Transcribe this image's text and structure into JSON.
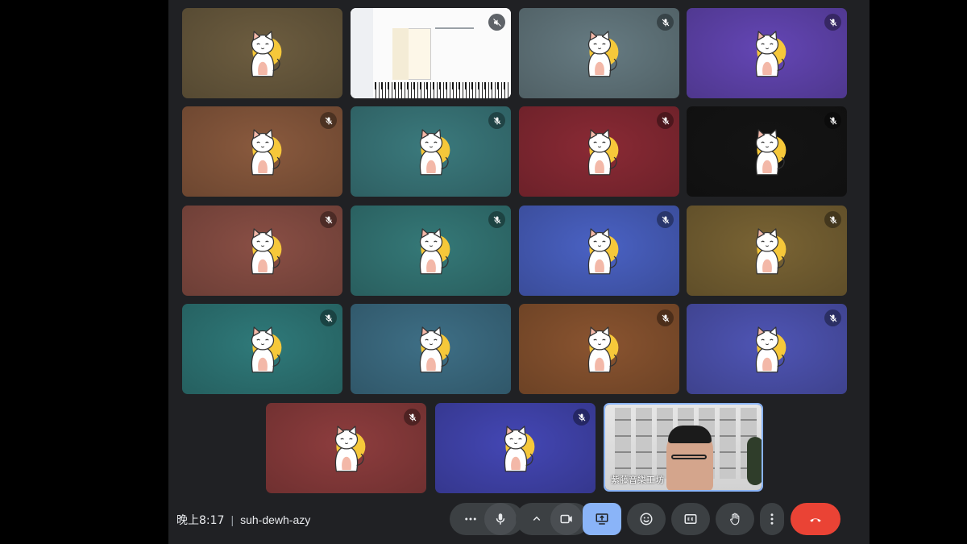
{
  "meeting": {
    "time": "晚上8:17",
    "separator": "|",
    "code": "suh-dewh-azy"
  },
  "self": {
    "name": "紫藤音樂工坊"
  },
  "colors": {
    "stage_bg": "#202124",
    "control_bg": "#3c4043",
    "present_active": "#8ab4f8",
    "end_call": "#ea4335",
    "self_border": "#8ab4f8"
  },
  "tiles": [
    {
      "row": 1,
      "col": 1,
      "kind": "avatar",
      "muted": false,
      "bg": "#6d5d40"
    },
    {
      "row": 1,
      "col": 2,
      "kind": "screen-share",
      "muted": false,
      "audio_off": true
    },
    {
      "row": 1,
      "col": 3,
      "kind": "avatar",
      "muted": true,
      "bg": "#667b82"
    },
    {
      "row": 1,
      "col": 4,
      "kind": "avatar",
      "muted": true,
      "bg": "#6446b5"
    },
    {
      "row": 2,
      "col": 1,
      "kind": "avatar",
      "muted": true,
      "bg": "#8a5a3e"
    },
    {
      "row": 2,
      "col": 2,
      "kind": "avatar",
      "muted": true,
      "bg": "#3b7a7d"
    },
    {
      "row": 2,
      "col": 3,
      "kind": "avatar",
      "muted": true,
      "bg": "#8a2a35"
    },
    {
      "row": 2,
      "col": 4,
      "kind": "avatar",
      "muted": true,
      "bg": "#141414"
    },
    {
      "row": 3,
      "col": 1,
      "kind": "avatar",
      "muted": true,
      "bg": "#8a4f45"
    },
    {
      "row": 3,
      "col": 2,
      "kind": "avatar",
      "muted": true,
      "bg": "#357978"
    },
    {
      "row": 3,
      "col": 3,
      "kind": "avatar",
      "muted": true,
      "bg": "#4a62c4"
    },
    {
      "row": 3,
      "col": 4,
      "kind": "avatar",
      "muted": true,
      "bg": "#7a6434"
    },
    {
      "row": 4,
      "col": 1,
      "kind": "avatar",
      "muted": true,
      "bg": "#2f7a7a"
    },
    {
      "row": 4,
      "col": 2,
      "kind": "avatar",
      "muted": false,
      "bg": "#3e6f86"
    },
    {
      "row": 4,
      "col": 3,
      "kind": "avatar",
      "muted": true,
      "bg": "#8a5430"
    },
    {
      "row": 4,
      "col": 4,
      "kind": "avatar",
      "muted": true,
      "bg": "#4f55b5"
    },
    {
      "row": 5,
      "col": 1,
      "kind": "avatar",
      "muted": true,
      "bg": "#8e3d3e"
    },
    {
      "row": 5,
      "col": 2,
      "kind": "avatar",
      "muted": true,
      "bg": "#4447b5"
    },
    {
      "row": 5,
      "col": 3,
      "kind": "self-video",
      "muted": false
    }
  ],
  "controls": [
    {
      "id": "more-options-left",
      "icon": "more-horiz-icon"
    },
    {
      "id": "microphone",
      "icon": "mic-icon"
    },
    {
      "id": "camera-options",
      "icon": "chevron-up-icon"
    },
    {
      "id": "camera",
      "icon": "videocam-icon"
    },
    {
      "id": "present",
      "icon": "present-screen-icon",
      "active": true
    },
    {
      "id": "reactions",
      "icon": "emoji-icon"
    },
    {
      "id": "captions",
      "icon": "captions-icon"
    },
    {
      "id": "raise-hand",
      "icon": "hand-icon"
    },
    {
      "id": "more-options",
      "icon": "more-vert-icon"
    },
    {
      "id": "leave-call",
      "icon": "call-end-icon"
    }
  ]
}
